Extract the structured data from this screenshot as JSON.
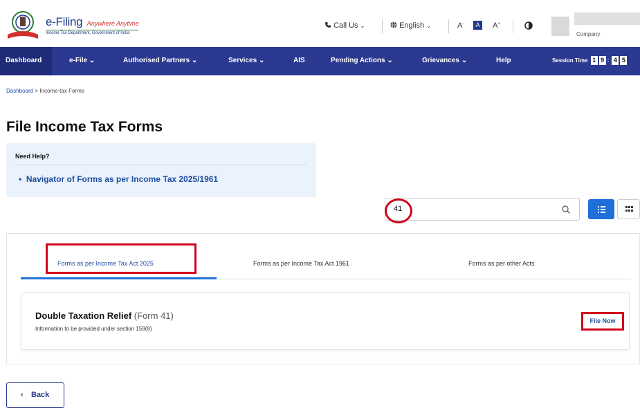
{
  "header": {
    "brand_name": "e-Filing",
    "brand_tagline": "Anywhere Anytime",
    "brand_sub": "Income Tax Department, Government of India",
    "call_us": "Call Us",
    "language": "English",
    "font_decrease": "A",
    "font_reset": "A",
    "font_increase": "A",
    "user_type": "Company"
  },
  "nav": {
    "items": [
      "Dashboard",
      "e-File",
      "Authorised Partners",
      "Services",
      "AIS",
      "Pending Actions",
      "Grievances",
      "Help"
    ],
    "session_label": "Session Time",
    "session_digits": [
      "1",
      "9",
      ":",
      "4",
      "5"
    ]
  },
  "breadcrumb": {
    "home": "Dashboard",
    "separator": ">",
    "current": "Income-tax Forms"
  },
  "page_title": "File Income Tax Forms",
  "help": {
    "title": "Need Help?",
    "link": "Navigator of Forms as per Income Tax 2025/1961"
  },
  "search": {
    "value": "41"
  },
  "tabs": [
    "Forms as per Income Tax Act 2025",
    "Forms as per Income Tax Act 1961",
    "Forms as per other Acts"
  ],
  "form": {
    "title": "Double Taxation Relief",
    "code": "(Form 41)",
    "description": "Information to be provided under section 159(8)",
    "action": "File Now"
  },
  "back_label": "Back",
  "colors": {
    "nav_bg": "#2b3990",
    "accent": "#1f6fd8",
    "link": "#1f4ea3",
    "annotation": "#d0021b"
  }
}
